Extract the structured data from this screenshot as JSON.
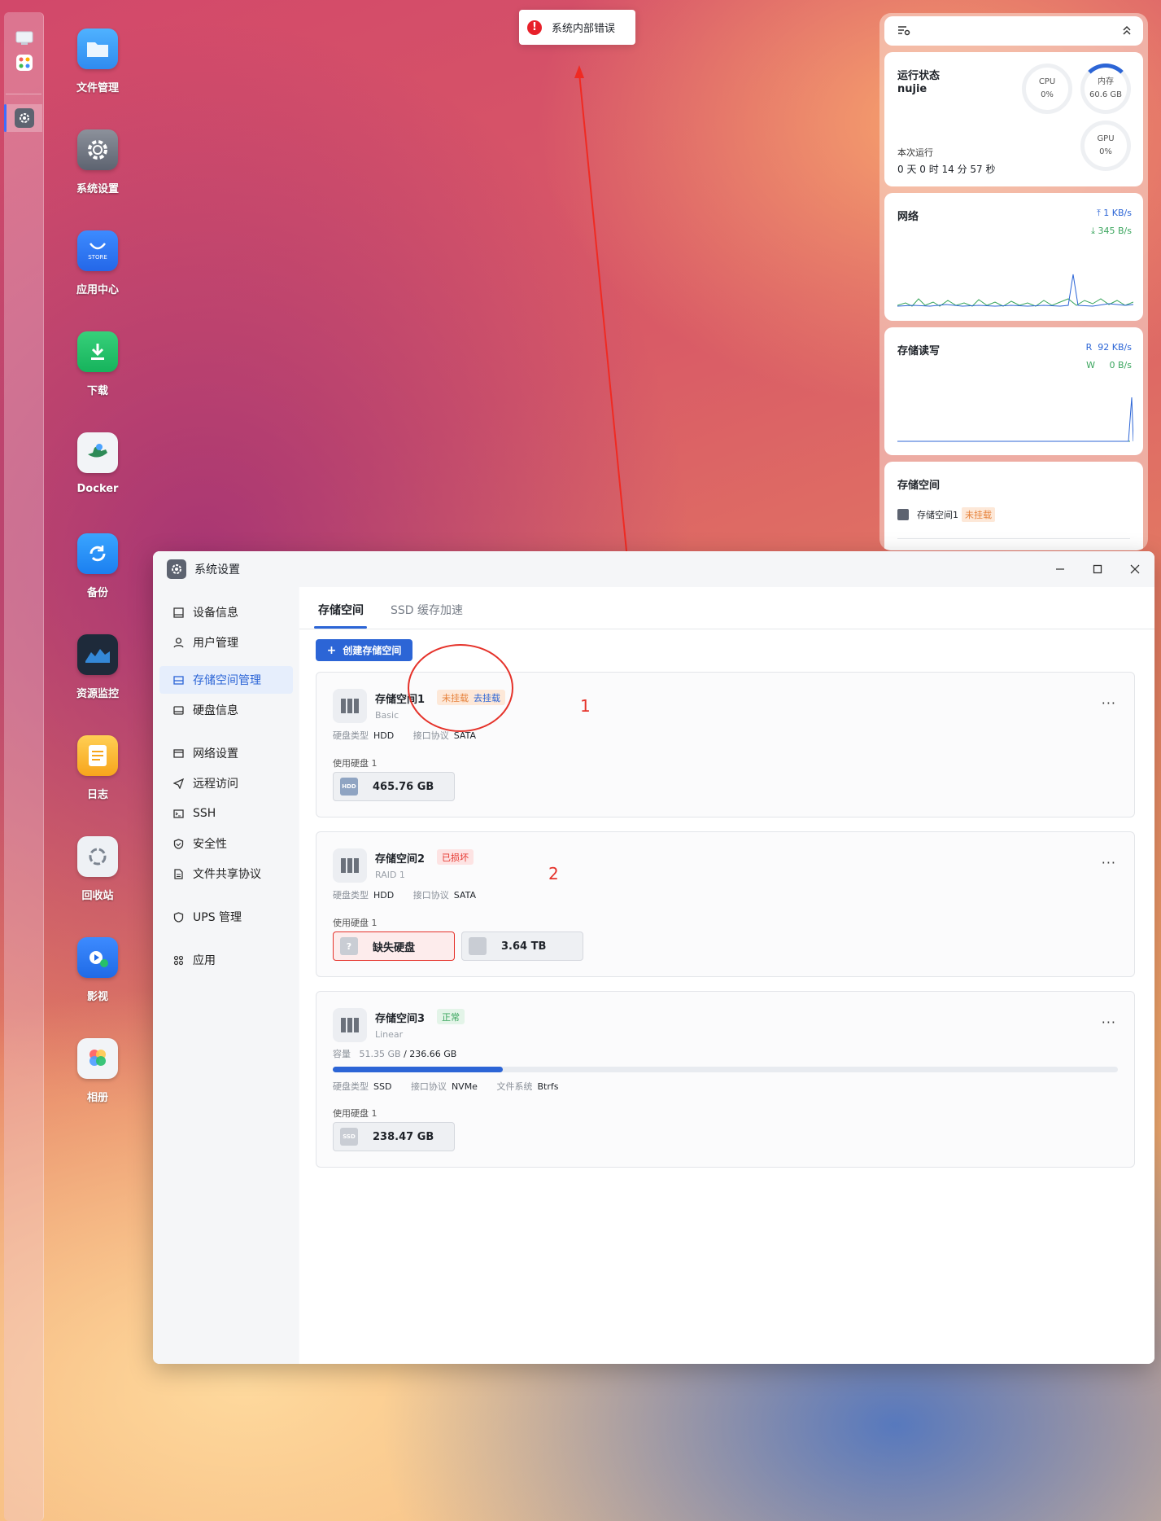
{
  "toast": {
    "message": "系统内部错误"
  },
  "desktop": {
    "icons": [
      {
        "label": "文件管理",
        "icon": "folder-icon"
      },
      {
        "label": "系统设置",
        "icon": "gear-icon"
      },
      {
        "label": "应用中心",
        "icon": "store-icon",
        "sublabel": "STORE"
      },
      {
        "label": "下载",
        "icon": "download-icon"
      },
      {
        "label": "Docker",
        "icon": "docker-icon"
      },
      {
        "label": "备份",
        "icon": "backup-icon"
      },
      {
        "label": "资源监控",
        "icon": "monitor-icon"
      },
      {
        "label": "日志",
        "icon": "log-icon"
      },
      {
        "label": "回收站",
        "icon": "recycle-icon"
      },
      {
        "label": "影视",
        "icon": "video-icon"
      },
      {
        "label": "相册",
        "icon": "photos-icon"
      }
    ]
  },
  "widgets": {
    "status": {
      "title": "运行状态",
      "host": "nujie",
      "cpu_label": "CPU",
      "cpu_value": "0%",
      "mem_label": "内存",
      "mem_value": "60.6 GB",
      "gpu_label": "GPU",
      "gpu_value": "0%",
      "uptime_label": "本次运行",
      "uptime_value": "0 天 0 时 14 分 57 秒"
    },
    "network": {
      "title": "网络",
      "up": "1 KB/s",
      "down": "345 B/s"
    },
    "storage_io": {
      "title": "存储读写",
      "read_label": "R",
      "read": "92 KB/s",
      "write_label": "W",
      "write": "0 B/s"
    },
    "storage": {
      "title": "存储空间",
      "item_name": "存储空间1",
      "item_badge": "未挂载"
    }
  },
  "window": {
    "title": "系统设置",
    "nav": [
      {
        "label": "设备信息",
        "icon": "device-icon"
      },
      {
        "label": "用户管理",
        "icon": "user-icon"
      },
      {
        "label": "存储空间管理",
        "icon": "storage-icon",
        "active": true
      },
      {
        "label": "硬盘信息",
        "icon": "disk-icon"
      },
      {
        "label": "网络设置",
        "icon": "network-icon"
      },
      {
        "label": "远程访问",
        "icon": "remote-icon"
      },
      {
        "label": "SSH",
        "icon": "ssh-icon"
      },
      {
        "label": "安全性",
        "icon": "shield-icon"
      },
      {
        "label": "文件共享协议",
        "icon": "file-share-icon"
      },
      {
        "label": "UPS 管理",
        "icon": "ups-icon"
      },
      {
        "label": "应用",
        "icon": "apps-icon"
      }
    ],
    "tabs": [
      "存储空间",
      "SSD 缓存加速"
    ],
    "create_button": "创建存储空间",
    "pools": [
      {
        "name": "存储空间1",
        "type": "Basic",
        "badge": "未挂载",
        "action": "去挂载",
        "disk_type_label": "硬盘类型",
        "disk_type": "HDD",
        "iface_label": "接口协议",
        "iface": "SATA",
        "used_label": "使用硬盘 1",
        "disks": [
          "465.76 GB"
        ]
      },
      {
        "name": "存储空间2",
        "type": "RAID 1",
        "badge": "已损坏",
        "disk_type_label": "硬盘类型",
        "disk_type": "HDD",
        "iface_label": "接口协议",
        "iface": "SATA",
        "used_label": "使用硬盘 1",
        "disks": [
          "缺失硬盘",
          "3.64 TB"
        ]
      },
      {
        "name": "存储空间3",
        "type": "Linear",
        "badge": "正常",
        "capacity_label": "容量",
        "capacity_used": "51.35 GB",
        "capacity_sep": "/",
        "capacity_total": "236.66 GB",
        "usage_fraction": 0.217,
        "disk_type_label": "硬盘类型",
        "disk_type": "SSD",
        "iface_label": "接口协议",
        "iface": "NVMe",
        "fs_label": "文件系统",
        "fs": "Btrfs",
        "used_label": "使用硬盘 1",
        "disks": [
          "238.47 GB"
        ]
      }
    ],
    "annotations": [
      "1",
      "2"
    ]
  },
  "colors": {
    "accent": "#2c65d6",
    "warning": "#e6813a",
    "danger": "#e5322a",
    "success": "#3aa55d"
  }
}
